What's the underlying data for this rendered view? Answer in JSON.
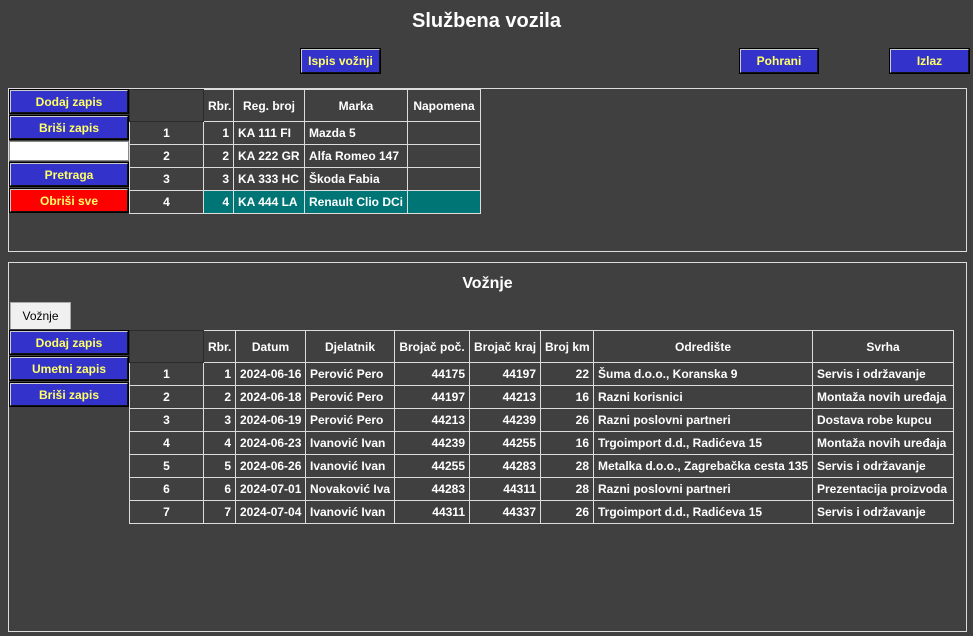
{
  "title": "Službena vozila",
  "toolbar": {
    "print_label": "Ispis vožnji",
    "save_label": "Pohrani",
    "exit_label": "Izlaz"
  },
  "vehicles": {
    "buttons": {
      "add": "Dodaj zapis",
      "delete": "Briši zapis",
      "search": "Pretraga",
      "clear_all": "Obriši sve"
    },
    "search_value": "",
    "columns": [
      "",
      "Rbr.",
      "Reg. broj",
      "Marka",
      "Napomena"
    ],
    "rows": [
      {
        "row_number": "1",
        "rbr": "1",
        "reg": "KA 111 FI",
        "marka": "Mazda 5",
        "napomena": ""
      },
      {
        "row_number": "2",
        "rbr": "2",
        "reg": "KA 222 GR",
        "marka": "Alfa Romeo 147",
        "napomena": ""
      },
      {
        "row_number": "3",
        "rbr": "3",
        "reg": "KA 333 HC",
        "marka": "Škoda Fabia",
        "napomena": ""
      },
      {
        "row_number": "4",
        "rbr": "4",
        "reg": "KA 444 LA",
        "marka": "Renault Clio DCi",
        "napomena": ""
      }
    ],
    "selected_row": 4
  },
  "trips": {
    "title": "Vožnje",
    "tab_label": "Vožnje",
    "buttons": {
      "add": "Dodaj zapis",
      "insert": "Umetni zapis",
      "delete": "Briši zapis"
    },
    "columns": [
      "",
      "Rbr.",
      "Datum",
      "Djelatnik",
      "Brojač poč.",
      "Brojač kraj",
      "Broj km",
      "Odredište",
      "Svrha"
    ],
    "rows": [
      {
        "row_number": "1",
        "rbr": "1",
        "datum": "2024-06-16",
        "djelatnik": "Perović Pero",
        "start": "44175",
        "end": "44197",
        "km": "22",
        "odrediste": "Šuma d.o.o., Koranska 9",
        "svrha": "Servis i održavanje"
      },
      {
        "row_number": "2",
        "rbr": "2",
        "datum": "2024-06-18",
        "djelatnik": "Perović Pero",
        "start": "44197",
        "end": "44213",
        "km": "16",
        "odrediste": "Razni korisnici",
        "svrha": "Montaža novih uređaja"
      },
      {
        "row_number": "3",
        "rbr": "3",
        "datum": "2024-06-19",
        "djelatnik": "Perović Pero",
        "start": "44213",
        "end": "44239",
        "km": "26",
        "odrediste": "Razni poslovni partneri",
        "svrha": "Dostava robe kupcu"
      },
      {
        "row_number": "4",
        "rbr": "4",
        "datum": "2024-06-23",
        "djelatnik": "Ivanović Ivan",
        "start": "44239",
        "end": "44255",
        "km": "16",
        "odrediste": "Trgoimport d.d., Radićeva 15",
        "svrha": "Montaža novih uređaja"
      },
      {
        "row_number": "5",
        "rbr": "5",
        "datum": "2024-06-26",
        "djelatnik": "Ivanović Ivan",
        "start": "44255",
        "end": "44283",
        "km": "28",
        "odrediste": "Metalka d.o.o., Zagrebačka cesta 135",
        "svrha": "Servis i održavanje"
      },
      {
        "row_number": "6",
        "rbr": "6",
        "datum": "2024-07-01",
        "djelatnik": "Novaković Iva",
        "start": "44283",
        "end": "44311",
        "km": "28",
        "odrediste": "Razni poslovni partneri",
        "svrha": "Prezentacija proizvoda"
      },
      {
        "row_number": "7",
        "rbr": "7",
        "datum": "2024-07-04",
        "djelatnik": "Ivanović Ivan",
        "start": "44311",
        "end": "44337",
        "km": "26",
        "odrediste": "Trgoimport d.d., Radićeva 15",
        "svrha": "Servis i održavanje"
      }
    ]
  },
  "colors": {
    "background": "#404040",
    "button": "#3333cc",
    "button_text": "#ffff66",
    "danger_button": "#ff0000",
    "selected_row": "#007575"
  }
}
